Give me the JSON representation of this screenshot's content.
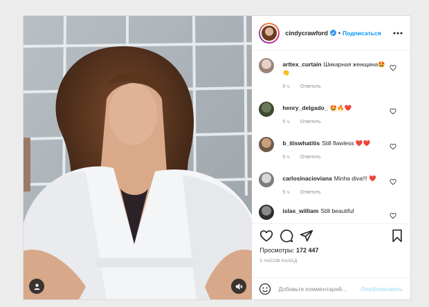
{
  "post": {
    "username": "cindycrawford",
    "follow_label": "Подписаться",
    "separator": "•"
  },
  "comments": [
    {
      "user": "arttex_curtain",
      "text": "Шикарная женщина🤩👏",
      "time": "5 ч.",
      "reply": "Ответить"
    },
    {
      "user": "henry_delgado_",
      "text": "🤩🔥❤️",
      "time": "5 ч.",
      "reply": "Ответить"
    },
    {
      "user": "b_itiswhatitis",
      "text": "Still flawless ❤️❤️",
      "time": "5 ч.",
      "reply": "Ответить"
    },
    {
      "user": "carlosinacioviana",
      "text": "Minha diva!!! ❤️",
      "time": "5 ч.",
      "reply": "Ответить"
    },
    {
      "user": "islas_william",
      "text": "Still beautiful",
      "time": "",
      "reply": ""
    }
  ],
  "stats": {
    "views_label": "Просмотры:",
    "views_value": "172 447",
    "time_ago": "5 ЧАСОВ НАЗАД"
  },
  "add_comment": {
    "placeholder": "Добавьте комментарий...",
    "publish_label": "Опубликовать"
  },
  "colors": {
    "accent": "#0095f6",
    "publish_disabled": "#b2dffc",
    "muted": "#8e8e8e",
    "heart": "#e0245e"
  },
  "icons": [
    "user-tag-icon",
    "mute-icon",
    "verified-icon",
    "more-icon",
    "heart-icon",
    "comment-icon",
    "share-icon",
    "bookmark-icon",
    "emoji-icon"
  ]
}
